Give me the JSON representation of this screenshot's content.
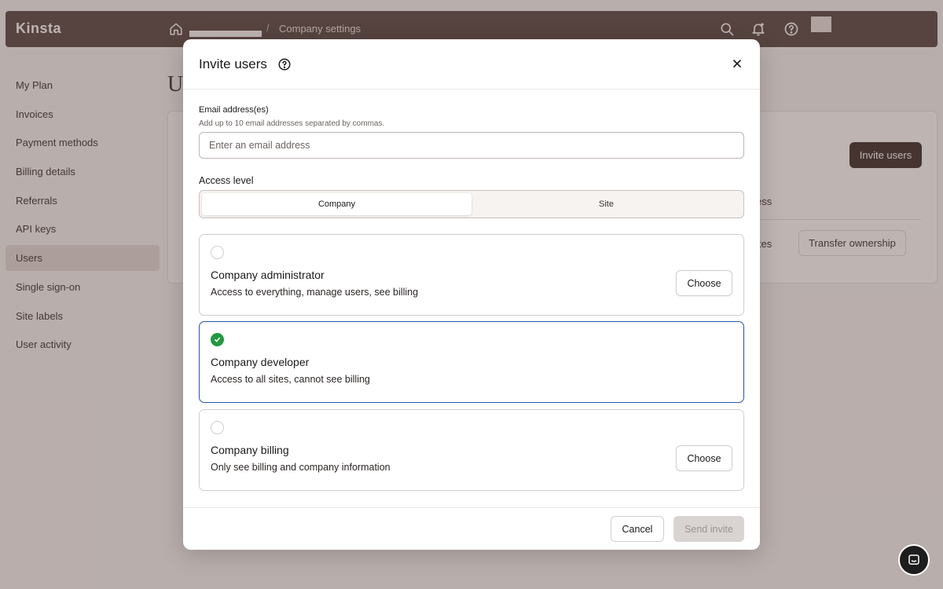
{
  "topbar": {
    "logo": "Kinsta",
    "breadcrumb_current": "Company settings",
    "breadcrumb_separator": "/"
  },
  "sidebar": {
    "items": [
      {
        "label": "My Plan",
        "active": false
      },
      {
        "label": "Invoices",
        "active": false
      },
      {
        "label": "Payment methods",
        "active": false
      },
      {
        "label": "Billing details",
        "active": false
      },
      {
        "label": "Referrals",
        "active": false
      },
      {
        "label": "API keys",
        "active": false
      },
      {
        "label": "Users",
        "active": true
      },
      {
        "label": "Single sign-on",
        "active": false
      },
      {
        "label": "Site labels",
        "active": false
      },
      {
        "label": "User activity",
        "active": false
      }
    ]
  },
  "background": {
    "page_title_peek": "U",
    "invite_users_label": "Invite users",
    "column_peek": "ess",
    "cell_peek": "ites",
    "transfer_ownership_label": "Transfer ownership"
  },
  "modal": {
    "title": "Invite users",
    "email": {
      "label": "Email address(es)",
      "hint": "Add up to 10 email addresses separated by commas.",
      "placeholder": "Enter an email address",
      "value": ""
    },
    "access_level": {
      "label": "Access level",
      "tabs": [
        "Company",
        "Site"
      ],
      "selected_tab": "Company"
    },
    "roles": [
      {
        "name": "Company administrator",
        "description": "Access to everything, manage users, see billing",
        "selected": false,
        "action": "Choose"
      },
      {
        "name": "Company developer",
        "description": "Access to all sites, cannot see billing",
        "selected": true,
        "action": ""
      },
      {
        "name": "Company billing",
        "description": "Only see billing and company information",
        "selected": false,
        "action": "Choose"
      }
    ],
    "footer": {
      "cancel_label": "Cancel",
      "send_label": "Send invite"
    }
  },
  "colors": {
    "topbar_bg": "#5a4a46",
    "selected_border": "#2a56b0",
    "selected_check": "#1f9a3e",
    "primary_button": "#3d302d",
    "disabled_button": "#d9d4d2"
  }
}
